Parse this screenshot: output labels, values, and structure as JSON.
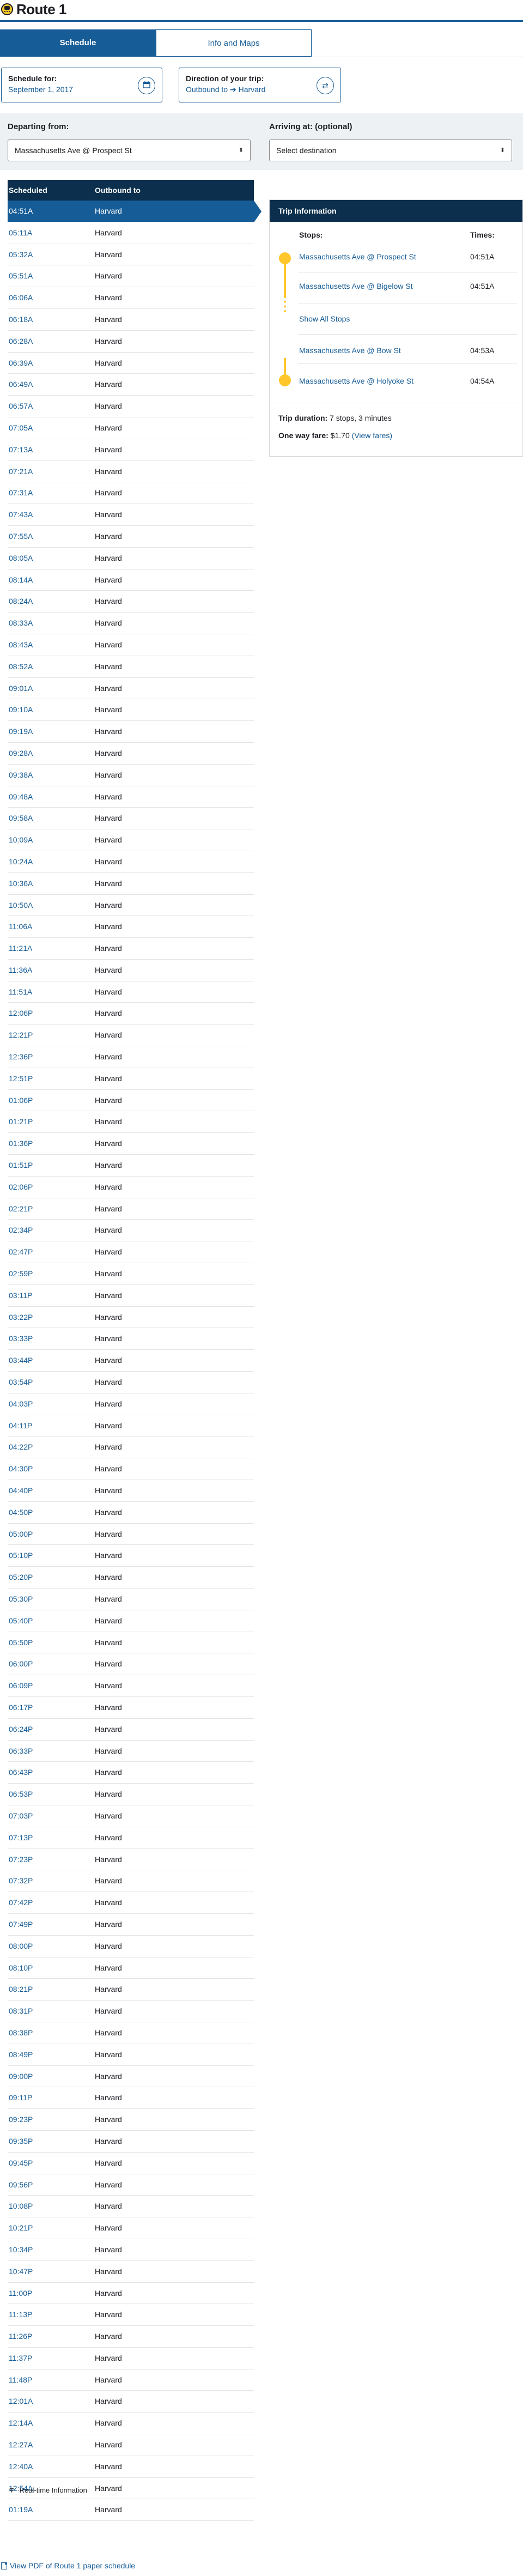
{
  "route": {
    "title": "Route 1"
  },
  "tabs": [
    {
      "label": "Schedule",
      "active": true
    },
    {
      "label": "Info and Maps",
      "active": false
    }
  ],
  "schedule_card": {
    "label": "Schedule for:",
    "value": "September 1, 2017"
  },
  "direction_card": {
    "label": "Direction of your trip:",
    "value_prefix": "Outbound to",
    "value_dest": "Harvard"
  },
  "departing": {
    "label": "Departing from:",
    "value": "Massachusetts Ave @ Prospect St"
  },
  "arriving": {
    "label": "Arriving at: (optional)",
    "placeholder": "Select destination"
  },
  "table": {
    "col_scheduled": "Scheduled",
    "col_outbound": "Outbound to",
    "destination": "Harvard",
    "selected_index": 0,
    "times": [
      "04:51A",
      "05:11A",
      "05:32A",
      "05:51A",
      "06:06A",
      "06:18A",
      "06:28A",
      "06:39A",
      "06:49A",
      "06:57A",
      "07:05A",
      "07:13A",
      "07:21A",
      "07:31A",
      "07:43A",
      "07:55A",
      "08:05A",
      "08:14A",
      "08:24A",
      "08:33A",
      "08:43A",
      "08:52A",
      "09:01A",
      "09:10A",
      "09:19A",
      "09:28A",
      "09:38A",
      "09:48A",
      "09:58A",
      "10:09A",
      "10:24A",
      "10:36A",
      "10:50A",
      "11:06A",
      "11:21A",
      "11:36A",
      "11:51A",
      "12:06P",
      "12:21P",
      "12:36P",
      "12:51P",
      "01:06P",
      "01:21P",
      "01:36P",
      "01:51P",
      "02:06P",
      "02:21P",
      "02:34P",
      "02:47P",
      "02:59P",
      "03:11P",
      "03:22P",
      "03:33P",
      "03:44P",
      "03:54P",
      "04:03P",
      "04:11P",
      "04:22P",
      "04:30P",
      "04:40P",
      "04:50P",
      "05:00P",
      "05:10P",
      "05:20P",
      "05:30P",
      "05:40P",
      "05:50P",
      "06:00P",
      "06:09P",
      "06:17P",
      "06:24P",
      "06:33P",
      "06:43P",
      "06:53P",
      "07:03P",
      "07:13P",
      "07:23P",
      "07:32P",
      "07:42P",
      "07:49P",
      "08:00P",
      "08:10P",
      "08:21P",
      "08:31P",
      "08:38P",
      "08:49P",
      "09:00P",
      "09:11P",
      "09:23P",
      "09:35P",
      "09:45P",
      "09:56P",
      "10:08P",
      "10:21P",
      "10:34P",
      "10:47P",
      "11:00P",
      "11:13P",
      "11:26P",
      "11:37P",
      "11:48P",
      "12:01A",
      "12:14A",
      "12:27A",
      "12:40A",
      "12:54A",
      "01:19A"
    ]
  },
  "links": {
    "realtime": "Real-time Information",
    "pdf": "View PDF of Route 1 paper schedule"
  },
  "trip": {
    "header": "Trip Information",
    "stops_label": "Stops:",
    "times_label": "Times:",
    "show_all": "Show All Stops",
    "stops": [
      {
        "name": "Massachusetts Ave @ Prospect St",
        "time": "04:51A"
      },
      {
        "name": "Massachusetts Ave @ Bigelow St",
        "time": "04:51A"
      },
      {
        "name": "Massachusetts Ave @ Bow St",
        "time": "04:53A"
      },
      {
        "name": "Massachusetts Ave @ Holyoke St",
        "time": "04:54A"
      }
    ],
    "duration_label": "Trip duration:",
    "duration_value": "7 stops, 3 minutes",
    "fare_label": "One way fare:",
    "fare_value": "$1.70",
    "fare_link": "(View fares)"
  },
  "colors": {
    "brand_blue": "#165c96",
    "navy": "#0b2f4c",
    "bus_yellow": "#ffc72c"
  },
  "icons": {
    "route": "bus-icon",
    "calendar": "calendar-icon",
    "swap": "swap-icon",
    "realtime": "wifi-icon",
    "pdf": "document-icon"
  }
}
